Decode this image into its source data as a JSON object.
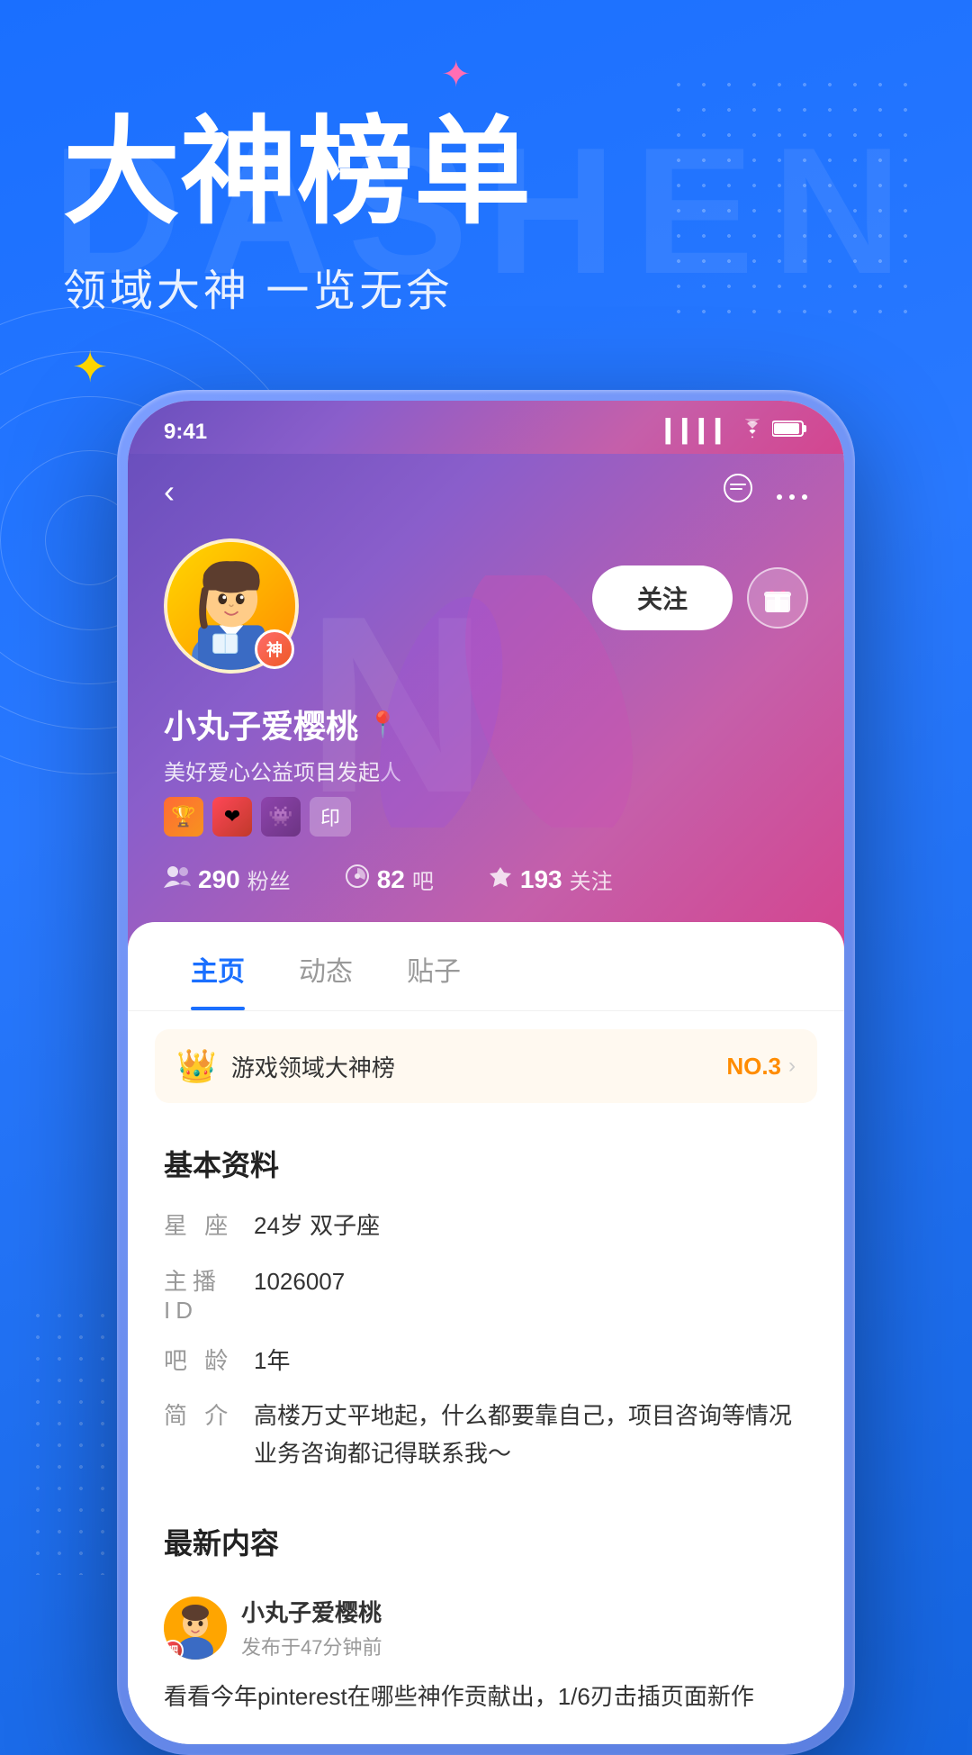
{
  "page": {
    "background_title": "DASHEN",
    "main_title": "大神榜单",
    "subtitle": "领域大神  一览无余"
  },
  "phone": {
    "status_bar": {
      "time": "9:41",
      "signal": "●●●●",
      "wifi": "wifi",
      "battery": "battery"
    },
    "nav": {
      "back_label": "‹",
      "chat_icon": "message",
      "more_icon": "•••"
    },
    "profile": {
      "name": "小丸子爱樱桃",
      "bio": "美好爱心公益项目发起人",
      "badge_label": "神",
      "location_icon": "📍",
      "badges": [
        "🏆",
        "❤",
        "👾",
        "印"
      ],
      "follow_label": "关注",
      "gift_icon": "🎁",
      "stats": {
        "fans": "290",
        "fans_label": "粉丝",
        "bars": "82",
        "bars_label": "吧",
        "following": "193",
        "following_label": "关注"
      }
    },
    "tabs": [
      "主页",
      "动态",
      "贴子"
    ],
    "active_tab": 0,
    "rank_banner": {
      "title": "游戏领域大神榜",
      "rank": "NO.3",
      "arrow": "›"
    },
    "basic_info": {
      "section_title": "基本资料",
      "rows": [
        {
          "label": "星  座",
          "value": "24岁  双子座"
        },
        {
          "label": "主播ID",
          "value": "1026007"
        },
        {
          "label": "吧  龄",
          "value": "1年"
        },
        {
          "label": "简  介",
          "value": "高楼万丈平地起，什么都要靠自己，项目咨询等情况业务咨询都记得联系我～"
        }
      ]
    },
    "latest_content": {
      "section_title": "最新内容",
      "post": {
        "username": "小丸子爱樱桃",
        "time": "发布于47分钟前",
        "preview": "看看今年pinterest在哪些神作贡献出，1/6刃击插页面新作"
      }
    }
  },
  "decorations": {
    "star_pink": "✦",
    "star_yellow": "✦"
  }
}
